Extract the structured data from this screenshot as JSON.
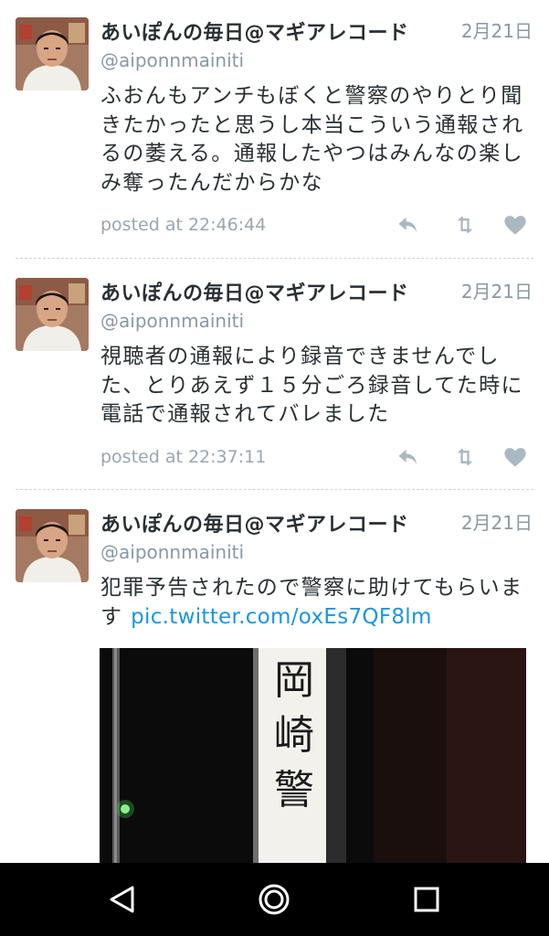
{
  "tweets": [
    {
      "user_name": "あいぽんの毎日@マギアレコード",
      "handle": "@aiponnmainiti",
      "date": "2月21日",
      "text_lines": [
        "ふおんもアンチもぼくと警察のやりとり聞",
        "きたかったと思うし本当こういう通報され",
        "るの萎える。通報したやつはみんなの楽し",
        "み奪ったんだからかな"
      ],
      "posted_at": "posted at 22:46:44"
    },
    {
      "user_name": "あいぽんの毎日@マギアレコード",
      "handle": "@aiponnmainiti",
      "date": "2月21日",
      "text_lines": [
        "視聴者の通報により録音できませんでし",
        "た、とりあえず１５分ごろ録音してた時に",
        "電話で通報されてバレました"
      ],
      "posted_at": "posted at 22:37:11"
    },
    {
      "user_name": "あいぽんの毎日@マギアレコード",
      "handle": "@aiponnmainiti",
      "date": "2月21日",
      "text_line1": "犯罪予告されたので警察に助けてもらいま",
      "text_line2_prefix": "す ",
      "link": "pic.twitter.com/oxEs7QF8lm",
      "photo_sign_text": [
        "岡",
        "崎",
        "警"
      ]
    }
  ],
  "icons": {
    "reply": "reply-icon",
    "retweet": "retweet-icon",
    "like": "heart-icon",
    "nav_back": "back-triangle-icon",
    "nav_home": "home-circle-icon",
    "nav_recents": "recents-square-icon"
  },
  "colors": {
    "name": "#292f33",
    "meta": "#8899a6",
    "link": "#1b95e0",
    "action_icon": "#aab8c2",
    "navbar": "#000000"
  }
}
